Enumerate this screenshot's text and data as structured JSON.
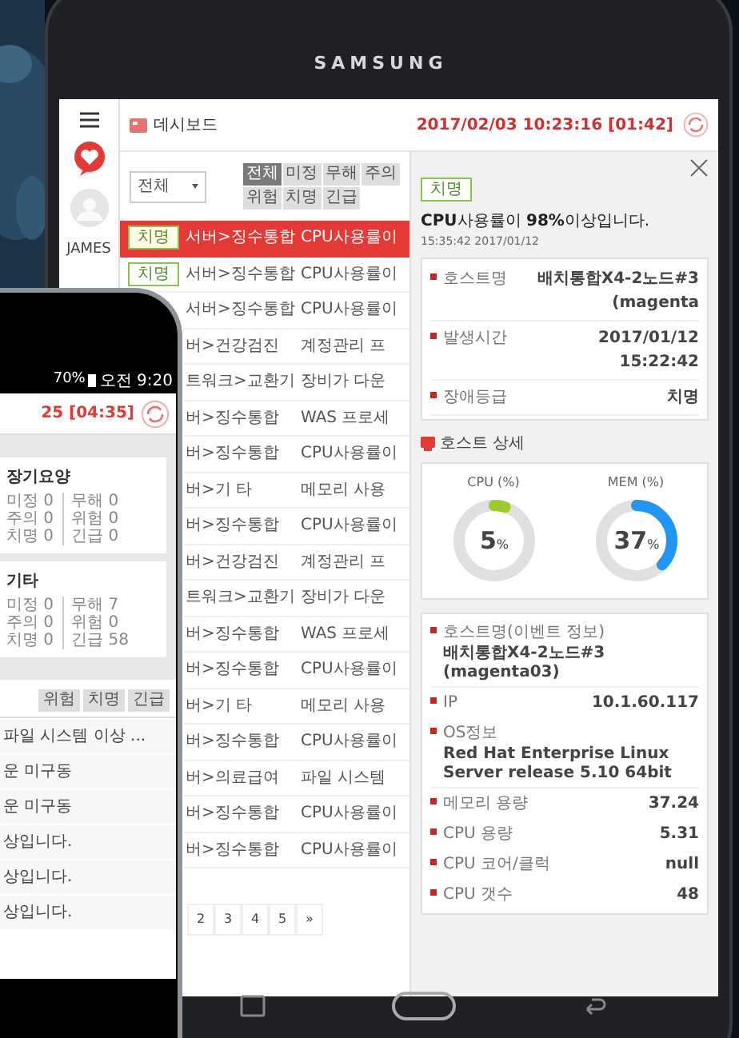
{
  "device_brand": "SAMSUNG",
  "tablet": {
    "sidebar": {
      "user": "JAMES"
    },
    "header": {
      "title": "데시보드",
      "datetime": "2017/02/03 10:23:16 [01:42]"
    },
    "filter_select": {
      "value": "전체"
    },
    "filter_buttons": [
      {
        "label": "전체",
        "selected": true
      },
      {
        "label": "미정",
        "selected": false
      },
      {
        "label": "무해",
        "selected": false
      },
      {
        "label": "주의",
        "selected": false
      },
      {
        "label": "위험",
        "selected": false
      },
      {
        "label": "치명",
        "selected": false
      },
      {
        "label": "긴급",
        "selected": false
      }
    ],
    "events": [
      {
        "level": "치명",
        "path": "서버>징수통합",
        "message": "CPU사용률이",
        "selected": true
      },
      {
        "level": "치명",
        "path": "서버>징수통합",
        "message": "CPU사용률이",
        "selected": false
      },
      {
        "path": "서버>징수통합",
        "message": "CPU사용률이",
        "selected": false
      },
      {
        "path": "버>건강검진",
        "message": "계정관리 프",
        "selected": false
      },
      {
        "path": "트워크>교환기",
        "message": "장비가 다운",
        "selected": false
      },
      {
        "path": "버>징수통합",
        "message": "WAS 프로세",
        "selected": false
      },
      {
        "path": "버>징수통합",
        "message": "CPU사용률이",
        "selected": false
      },
      {
        "path": "버>기 타",
        "message": "메모리 사용",
        "selected": false
      },
      {
        "path": "버>징수통합",
        "message": "CPU사용률이",
        "selected": false
      },
      {
        "path": "버>건강검진",
        "message": "계정관리 프",
        "selected": false
      },
      {
        "path": "트워크>교환기",
        "message": "장비가 다운",
        "selected": false
      },
      {
        "path": "버>징수통합",
        "message": "WAS 프로세",
        "selected": false
      },
      {
        "path": "버>징수통합",
        "message": "CPU사용률이",
        "selected": false
      },
      {
        "path": "버>기 타",
        "message": "메모리 사용",
        "selected": false
      },
      {
        "path": "버>징수통합",
        "message": "CPU사용률이",
        "selected": false
      },
      {
        "path": "버>의료급여",
        "message": "파일 시스템",
        "selected": false
      },
      {
        "path": "버>징수통합",
        "message": "CPU사용률이",
        "selected": false
      },
      {
        "path": "버>징수통합",
        "message": "CPU사용률이",
        "selected": false
      }
    ],
    "pagination": [
      "2",
      "3",
      "4",
      "5",
      "»"
    ],
    "detail": {
      "level": "치명",
      "title": "**CPU**사용률이 **98%**이상입니다.",
      "time": "15:35:42 2017/01/12",
      "summary": [
        {
          "label": "호스트명",
          "value": "배치통합X4-2노드#3 (magenta"
        },
        {
          "label": "발생시간",
          "value": "2017/01/12 15:22:42"
        },
        {
          "label": "장애등급",
          "value": "치명"
        }
      ],
      "section_title": "호스트 상세",
      "gauges": [
        {
          "label": "CPU (%)",
          "value": "5",
          "unit": "%",
          "level": 0.05,
          "color": "#9ccc2c"
        },
        {
          "label": "MEM (%)",
          "value": "37",
          "unit": "%",
          "level": 0.37,
          "color": "#2196f3"
        }
      ],
      "info": [
        {
          "kind": "stacked",
          "label": "호스트명(이벤트 정보)",
          "value": "배치통합X4-2노드#3 (magenta03)"
        },
        {
          "kind": "inline",
          "label": "IP",
          "value": "10.1.60.117"
        },
        {
          "kind": "stacked",
          "label": "OS정보",
          "value": "Red Hat Enterprise Linux Server release 5.10 64bit"
        },
        {
          "kind": "inline",
          "label": "메모리 용량",
          "value": "37.24"
        },
        {
          "kind": "inline",
          "label": "CPU 용량",
          "value": "5.31"
        },
        {
          "kind": "inline",
          "label": "CPU 코어/클럭",
          "value": "null"
        },
        {
          "kind": "inline",
          "label": "CPU 갯수",
          "value": "48"
        }
      ]
    }
  },
  "phone": {
    "status": {
      "battery": "70%",
      "time": "오전 9:20"
    },
    "datetime": "25 [04:35]",
    "cards": [
      {
        "title": "장기요양",
        "left": [
          "미정 0",
          "주의 0",
          "치명 0"
        ],
        "right": [
          "무해 0",
          "위험 0",
          "긴급 0"
        ]
      },
      {
        "title": "기타",
        "left": [
          "미정 0",
          "주의 0",
          "치명 0"
        ],
        "right": [
          "무해 7",
          "위험 0",
          "긴급 58"
        ]
      }
    ],
    "filter_buttons": [
      "위험",
      "치명",
      "긴급"
    ],
    "events": [
      "파일 시스템 이상 ...",
      "운 미구동",
      "운 미구동",
      "상입니다.",
      "상입니다.",
      "상입니다."
    ]
  }
}
